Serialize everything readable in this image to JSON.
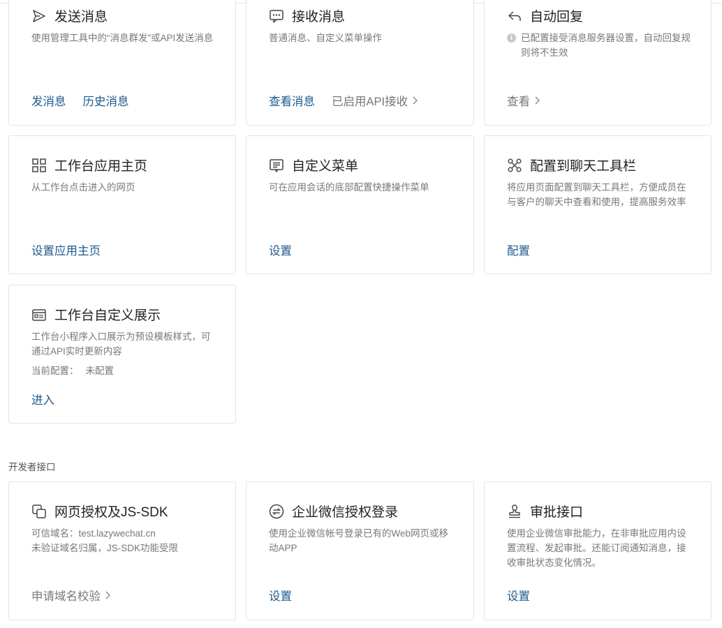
{
  "message_section": {
    "cards": [
      {
        "title": "发送消息",
        "icon": "send-icon",
        "desc": "使用管理工具中的“消息群发”或API发送消息",
        "links": [
          "发消息",
          "历史消息"
        ]
      },
      {
        "title": "接收消息",
        "icon": "chat-bubble-icon",
        "desc": "普通消息、自定义菜单操作",
        "links": [
          "查看消息"
        ],
        "status": "已启用API接收"
      },
      {
        "title": "自动回复",
        "icon": "reply-icon",
        "desc": "已配置接受消息服务器设置，自动回复规则将不生效",
        "muted_link": "查看"
      }
    ]
  },
  "workbench_section": {
    "cards": [
      {
        "title": "工作台应用主页",
        "icon": "grid-icon",
        "desc": "从工作台点击进入的网页",
        "link": "设置应用主页"
      },
      {
        "title": "自定义菜单",
        "icon": "menu-icon",
        "desc": "可在应用会话的底部配置快捷操作菜单",
        "link": "设置"
      },
      {
        "title": "配置到聊天工具栏",
        "icon": "toolbar-icon",
        "desc": "将应用页面配置到聊天工具栏，方便成员在与客户的聊天中查看和使用，提高服务效率",
        "link": "配置"
      },
      {
        "title": "工作台自定义展示",
        "icon": "display-icon",
        "desc": "工作台小程序入口展示为预设模板样式，可通过API实时更新内容",
        "config_label": "当前配置：",
        "config_value": "未配置",
        "link": "进入"
      }
    ]
  },
  "developer_section": {
    "label": "开发者接口",
    "cards": [
      {
        "title": "网页授权及JS-SDK",
        "icon": "web-auth-icon",
        "desc_line1": "可信域名：test.lazywechat.cn",
        "desc_line2": "未验证域名归属，JS-SDK功能受限",
        "muted_link": "申请域名校验"
      },
      {
        "title": "企业微信授权登录",
        "icon": "login-icon",
        "desc": "使用企业微信帐号登录已有的Web网页或移动APP",
        "link": "设置"
      },
      {
        "title": "审批接口",
        "icon": "stamp-icon",
        "desc": "使用企业微信审批能力，在非审批应用内设置流程、发起审批。还能订阅通知消息，接收审批状态变化情况。",
        "link": "设置"
      }
    ]
  },
  "colors": {
    "link": "#1f5a8c",
    "muted": "#787878",
    "border": "#e2e4e8"
  }
}
